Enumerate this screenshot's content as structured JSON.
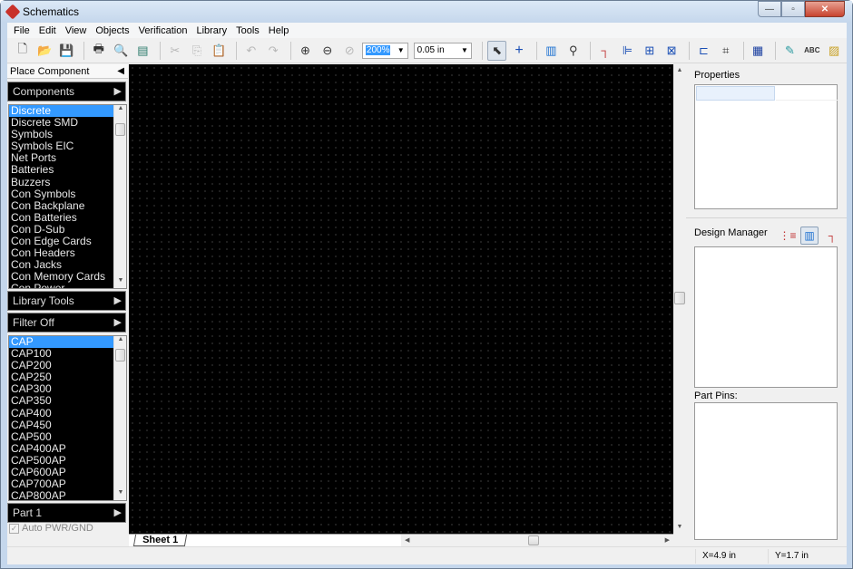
{
  "window": {
    "title": "Schematics",
    "minimize": "—",
    "maximize": "▫",
    "close": "✕"
  },
  "menu": [
    "File",
    "Edit",
    "View",
    "Objects",
    "Verification",
    "Library",
    "Tools",
    "Help"
  ],
  "toolbar": {
    "zoom_value": "200%",
    "grid_value": "0.05 in",
    "icons": [
      "new-file",
      "open-folder",
      "save",
      "print",
      "print-preview",
      "report",
      "cut",
      "copy",
      "paste",
      "undo",
      "redo",
      "zoom-in",
      "zoom-out",
      "zoom-fit",
      "select-pointer",
      "crosshair",
      "component",
      "find",
      "wire",
      "bus",
      "net-port",
      "netlist",
      "connector",
      "chip",
      "grid",
      "edit-text",
      "text-abc",
      "image"
    ]
  },
  "left_panel": {
    "place_component": "Place Component",
    "components_label": "Components",
    "categories": [
      "Discrete",
      "Discrete SMD",
      "Symbols",
      "Symbols EIC",
      "Net Ports",
      "Batteries",
      "Buzzers",
      "Con Symbols",
      "Con Backplane",
      "Con Batteries",
      "Con D-Sub",
      "Con Edge Cards",
      "Con Headers",
      "Con Jacks",
      "Con Memory Cards",
      "Con Power"
    ],
    "selected_category": "Discrete",
    "library_tools_label": "Library Tools",
    "filter_label": "Filter Off",
    "parts": [
      "CAP",
      "CAP100",
      "CAP200",
      "CAP250",
      "CAP300",
      "CAP350",
      "CAP400",
      "CAP450",
      "CAP500",
      "CAP400AP",
      "CAP500AP",
      "CAP600AP",
      "CAP700AP",
      "CAP800AP"
    ],
    "selected_part": "CAP",
    "part_label": "Part 1",
    "auto_pwr_gnd": "Auto PWR/GND",
    "auto_pwr_gnd_checked": true
  },
  "canvas": {
    "sheet_tab": "Sheet 1",
    "background": "#000000"
  },
  "right_panel": {
    "properties_label": "Properties",
    "design_manager_label": "Design Manager",
    "part_pins_label": "Part Pins:"
  },
  "status": {
    "x": "X=4.9 in",
    "y": "Y=1.7 in"
  },
  "colors": {
    "accent": "#3399ff",
    "close_button": "#c8432f"
  }
}
